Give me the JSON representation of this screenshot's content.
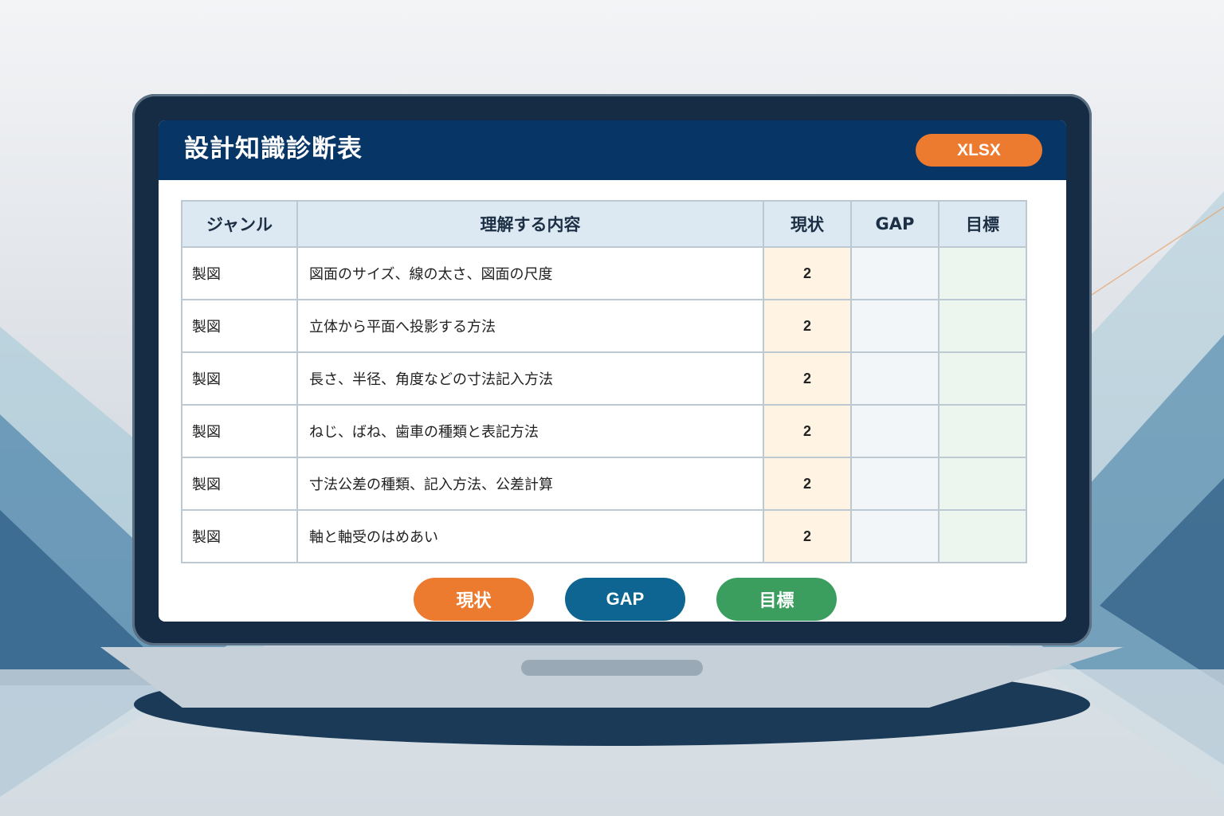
{
  "header": {
    "title": "設計知識診断表",
    "badge": "XLSX"
  },
  "table": {
    "columns": [
      "ジャンル",
      "理解する内容",
      "現状",
      "GAP",
      "目標"
    ],
    "rows": [
      {
        "genre": "製図",
        "content": "図面のサイズ、線の太さ、図面の尺度",
        "current": "2",
        "gap": "",
        "target": ""
      },
      {
        "genre": "製図",
        "content": "立体から平面へ投影する方法",
        "current": "2",
        "gap": "",
        "target": ""
      },
      {
        "genre": "製図",
        "content": "長さ、半径、角度などの寸法記入方法",
        "current": "2",
        "gap": "",
        "target": ""
      },
      {
        "genre": "製図",
        "content": "ねじ、ばね、歯車の種類と表記方法",
        "current": "2",
        "gap": "",
        "target": ""
      },
      {
        "genre": "製図",
        "content": "寸法公差の種類、記入方法、公差計算",
        "current": "2",
        "gap": "",
        "target": ""
      },
      {
        "genre": "製図",
        "content": "軸と軸受のはめあい",
        "current": "2",
        "gap": "",
        "target": ""
      }
    ]
  },
  "legend": {
    "current": "現状",
    "gap": "GAP",
    "target": "目標"
  },
  "colors": {
    "header_bg": "#073566",
    "current": "#ed7b2f",
    "gap": "#0e6592",
    "target": "#3b9e5f"
  }
}
